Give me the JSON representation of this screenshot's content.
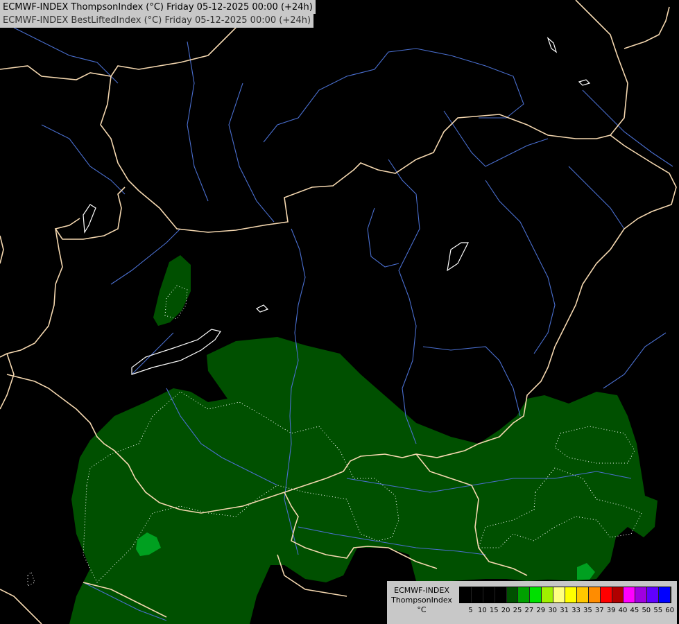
{
  "header": {
    "title_line1": "ECMWF-INDEX ThompsonIndex (°C) Friday 05-12-2025 00:00 (+24h)",
    "title_line2": "ECMWF-INDEX BestLiftedIndex (°C) Friday 05-12-2025 00:00 (+24h)"
  },
  "legend": {
    "model": "ECMWF-INDEX",
    "parameter": "ThompsonIndex",
    "unit": "°C",
    "ticks": [
      "5",
      "10",
      "15",
      "20",
      "25",
      "27",
      "29",
      "30",
      "31",
      "33",
      "35",
      "37",
      "39",
      "40",
      "45",
      "50",
      "55",
      "60"
    ],
    "colors": [
      "#000000",
      "#000000",
      "#000000",
      "#000000",
      "#005000",
      "#00a000",
      "#00e000",
      "#a0f000",
      "#ffff80",
      "#ffff00",
      "#ffc800",
      "#ff8c00",
      "#ff0000",
      "#b00000",
      "#ff00ff",
      "#a000e0",
      "#6000ff",
      "#0000ff"
    ]
  },
  "map": {
    "fill_colors": {
      "dark_green": "#005000",
      "mid_green": "#00a020"
    },
    "border_color": "#f5d8b0",
    "river_color": "#4a6fd0",
    "lake_outline": "#ffffff"
  }
}
